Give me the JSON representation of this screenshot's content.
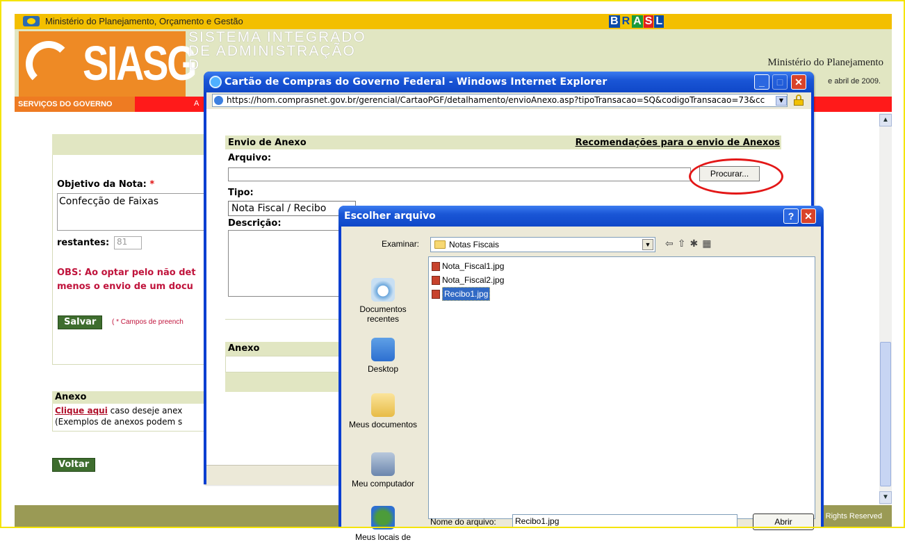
{
  "govbar": {
    "ministry": "Ministério do Planejamento, Orçamento e Gestão",
    "brasil_logo": "BRASIL"
  },
  "header": {
    "logo_word": "SIASG",
    "system_title_line1": "SISTEMA INTEGRADO",
    "system_title_line2": "DE ADMINISTRAÇÃO",
    "system_title_line3": "D",
    "ministry_right": "Ministério do Planejamento",
    "date_fragment": "e abril de 2009."
  },
  "menubar": {
    "first_tab": "SERVIÇOS DO GOVERNO",
    "fragment": "A"
  },
  "form": {
    "objetivo_label": "Objetivo da Nota:",
    "required_mark": "*",
    "objetivo_value": "Confecção de Faixas",
    "restantes_label": "restantes:",
    "restantes_value": "81",
    "obs_line1": "OBS: Ao optar pelo não det",
    "obs_line2": "menos o envio de um docu",
    "salvar": "Salvar",
    "note": "( * Campos de preench",
    "anexo_title": "Anexo",
    "clique_aqui": "Clique aqui",
    "anexo_text1": " caso deseje anex",
    "anexo_text2": "(Exemplos de anexos podem s",
    "voltar": "Voltar"
  },
  "footer": {
    "rights": "Rights Reserved"
  },
  "ie_window": {
    "title": "Cartão de Compras do Governo Federal - Windows Internet Explorer",
    "address": "https://hom.comprasnet.gov.br/gerencial/CartaoPGF/detalhamento/envioAnexo.asp?tipoTransacao=SQ&codigoTransacao=73&cc",
    "envio_title": "Envio de Anexo",
    "recomendacoes": "Recomendações para o envio de Anexos",
    "arquivo_label": "Arquivo:",
    "procurar": "Procurar...",
    "tipo_label": "Tipo:",
    "tipo_value": "Nota Fiscal / Recibo",
    "descricao_label": "Descrição:",
    "anexo_label": "Anexo"
  },
  "file_dialog": {
    "title": "Escolher arquivo",
    "examinar_label": "Examinar:",
    "current_folder": "Notas Fiscais",
    "places": [
      {
        "label": "Documentos recentes",
        "icon": "recent-documents-icon"
      },
      {
        "label": "Desktop",
        "icon": "desktop-icon"
      },
      {
        "label": "Meus documentos",
        "icon": "my-documents-icon"
      },
      {
        "label": "Meu computador",
        "icon": "my-computer-icon"
      },
      {
        "label": "Meus locais de",
        "icon": "network-places-icon"
      }
    ],
    "files": [
      {
        "name": "Nota_Fiscal1.jpg",
        "selected": false
      },
      {
        "name": "Nota_Fiscal2.jpg",
        "selected": false
      },
      {
        "name": "Recibo1.jpg",
        "selected": true
      }
    ],
    "nome_label": "Nome do arquivo:",
    "nome_value": "Recibo1.jpg",
    "abrir": "Abrir"
  }
}
